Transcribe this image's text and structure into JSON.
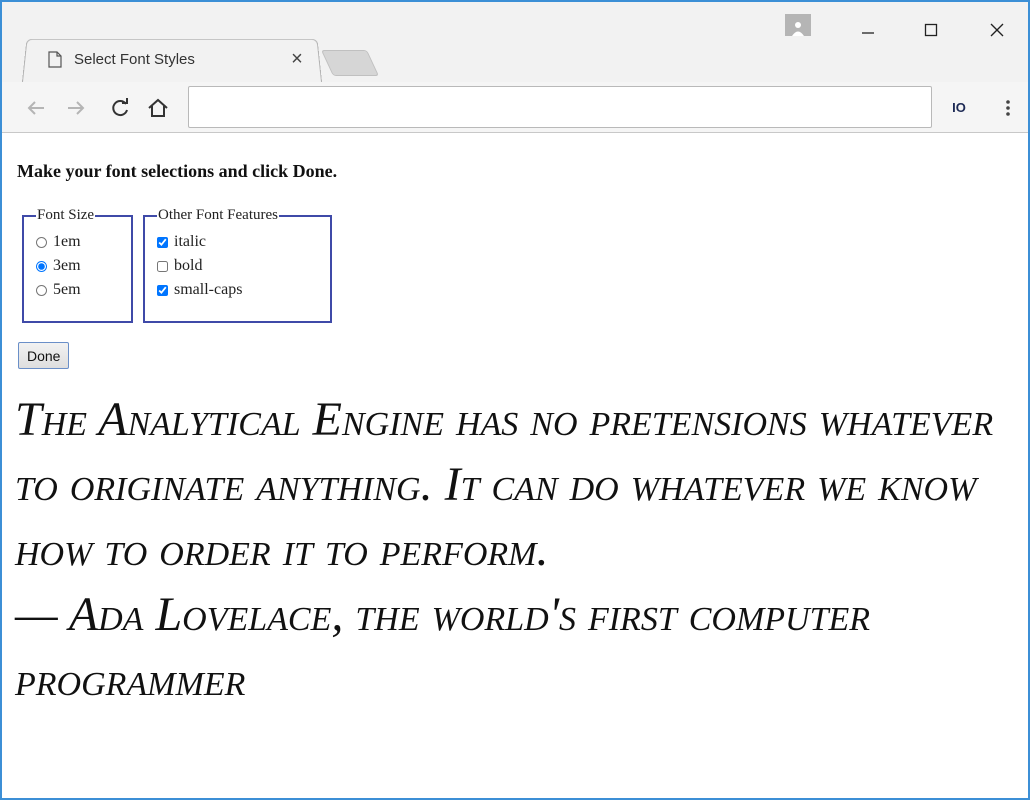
{
  "browser": {
    "tab_title": "Select Font Styles",
    "tab_close": "×",
    "address_value": "",
    "extension_label": "IO"
  },
  "page": {
    "instructions": "Make your font selections and click Done.",
    "font_size": {
      "legend": "Font Size",
      "options": [
        {
          "label": "1em",
          "checked": false
        },
        {
          "label": "3em",
          "checked": true
        },
        {
          "label": "5em",
          "checked": false
        }
      ]
    },
    "font_features": {
      "legend": "Other Font Features",
      "options": [
        {
          "label": "italic",
          "checked": true
        },
        {
          "label": "bold",
          "checked": false
        },
        {
          "label": "small-caps",
          "checked": true
        }
      ]
    },
    "done_label": "Done",
    "quote_line1": "The Analytical Engine has no pretensions whatever to originate anything. It can do whatever we know how to order it to perform.",
    "quote_line2": "— Ada Lovelace, the world's first computer programmer"
  },
  "colors": {
    "window_border": "#3c8fd6",
    "fieldset_border": "#3f4aa8"
  }
}
